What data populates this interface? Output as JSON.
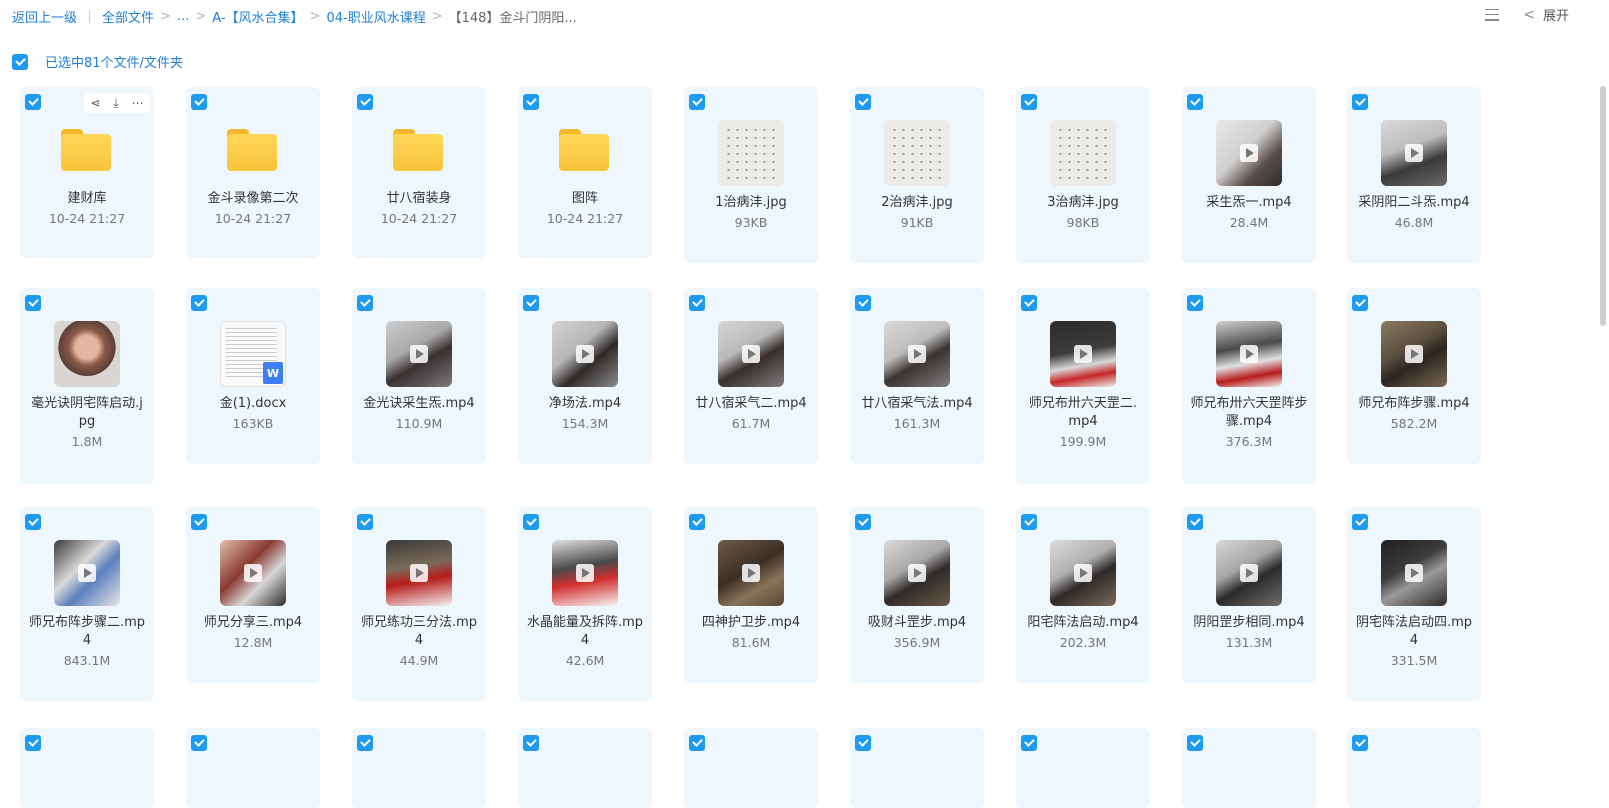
{
  "breadcrumb": {
    "back": "返回上一级",
    "all": "全部文件",
    "ellipsis": "...",
    "level1": "A-【风水合集】",
    "level2": "04-职业风水课程",
    "current": "【148】金斗门阴阳..."
  },
  "toolbar": {
    "expand_label": "展开"
  },
  "selection": {
    "label": "已选中81个文件/文件夹"
  },
  "colors": {
    "accent": "#1e9bf0",
    "card_bg": "#eef7fe",
    "link": "#1f7fd6"
  },
  "items": [
    {
      "name": "建财库",
      "meta": "10-24 21:27",
      "kind": "folder"
    },
    {
      "name": "金斗录像第二次",
      "meta": "10-24 21:27",
      "kind": "folder"
    },
    {
      "name": "廿八宿装身",
      "meta": "10-24 21:27",
      "kind": "folder"
    },
    {
      "name": "图阵",
      "meta": "10-24 21:27",
      "kind": "folder"
    },
    {
      "name": "1治病沣.jpg",
      "meta": "93KB",
      "kind": "paper"
    },
    {
      "name": "2治病沣.jpg",
      "meta": "91KB",
      "kind": "paper"
    },
    {
      "name": "3治病沣.jpg",
      "meta": "98KB",
      "kind": "paper"
    },
    {
      "name": "采生炁一.mp4",
      "meta": "28.4M",
      "kind": "video",
      "bg": "linear-gradient(135deg,#e9e9e9 0%,#cfcfcf 45%,#5a4f4a 70%,#2b2b2b 100%)"
    },
    {
      "name": "采阴阳二斗炁.mp4",
      "meta": "46.8M",
      "kind": "video",
      "bg": "linear-gradient(160deg,#d9d9d9 0%,#bdbdbd 40%,#3a3a3a 65%,#6a6a6a 100%)"
    },
    {
      "name": "毫光诀阴宅阵启动.jpg",
      "meta": "1.8M",
      "kind": "image",
      "bg": "radial-gradient(circle at 50% 40%,#e3b8a0 0 22%,#8a5a48 35%,#5a3f36 55%,#d9d6d2 56%)"
    },
    {
      "name": "金(1).docx",
      "meta": "163KB",
      "kind": "doc"
    },
    {
      "name": "金光诀采生炁.mp4",
      "meta": "110.9M",
      "kind": "video",
      "bg": "linear-gradient(150deg,#cdcdcd 0%,#a9a9a9 40%,#3a3030 60%,#7b7b7b 100%)"
    },
    {
      "name": "净场法.mp4",
      "meta": "154.3M",
      "kind": "video",
      "bg": "linear-gradient(140deg,#d2d2d2 0%,#b7b7b7 40%,#2e2a28 62%,#8d8d8d 100%)"
    },
    {
      "name": "廿八宿采气二.mp4",
      "meta": "61.7M",
      "kind": "video",
      "bg": "linear-gradient(150deg,#d6d6d6 0%,#b9b9b9 40%,#362e2a 60%,#7e7e7e 100%)"
    },
    {
      "name": "廿八宿采气法.mp4",
      "meta": "161.3M",
      "kind": "video",
      "bg": "linear-gradient(150deg,#d9d9d9 0%,#bdbdbd 40%,#3a3330 60%,#808080 100%)"
    },
    {
      "name": "师兄布卅六天罡二.mp4",
      "meta": "199.9M",
      "kind": "video",
      "bg": "linear-gradient(170deg,#2b2b2b 0%,#3c3c3c 45%,#d8d8d8 65%,#c62828 80%,#eeeeee 100%)"
    },
    {
      "name": "师兄布卅六天罡阵步骤.mp4",
      "meta": "376.3M",
      "kind": "video",
      "bg": "linear-gradient(170deg,#cfcfcf 0%,#4a4a4a 40%,#e0e0e0 62%,#b71c1c 80%,#f1f1f1 100%)"
    },
    {
      "name": "师兄布阵步骤.mp4",
      "meta": "582.2M",
      "kind": "video",
      "bg": "linear-gradient(150deg,#8a7a60 0%,#5c5040 40%,#2b2420 60%,#7a6a52 100%)"
    },
    {
      "name": "师兄布阵步骤二.mp4",
      "meta": "843.1M",
      "kind": "video",
      "bg": "linear-gradient(135deg,#3a3a3a 0%,#d9d9d9 40%,#5b7fbf 60%,#e6e6e6 100%)"
    },
    {
      "name": "师兄分享三.mp4",
      "meta": "12.8M",
      "kind": "video",
      "bg": "linear-gradient(135deg,#e1c0a8 0%,#8a3a32 40%,#d7d7d7 65%,#2a2a2a 100%)"
    },
    {
      "name": "师兄练功三分法.mp4",
      "meta": "44.9M",
      "kind": "video",
      "bg": "linear-gradient(170deg,#3a3a3a 0%,#7a6a5a 40%,#b71c1c 60%,#f2f2f2 100%)"
    },
    {
      "name": "水晶能量及拆阵.mp4",
      "meta": "42.6M",
      "kind": "video",
      "bg": "linear-gradient(170deg,#e0e0e0 0%,#4a4a4a 40%,#d32f2f 62%,#f5f5f5 100%)"
    },
    {
      "name": "四神护卫步.mp4",
      "meta": "81.6M",
      "kind": "video",
      "bg": "linear-gradient(150deg,#6e5a48 0%,#3a2e26 45%,#8a7258 70%,#5a4636 100%)"
    },
    {
      "name": "吸财斗罡步.mp4",
      "meta": "356.9M",
      "kind": "video",
      "bg": "linear-gradient(150deg,#d9d9d9 0%,#a8a8a8 40%,#2e2a28 60%,#6a5a48 100%)"
    },
    {
      "name": "阳宅阵法启动.mp4",
      "meta": "202.3M",
      "kind": "video",
      "bg": "linear-gradient(150deg,#dcdcdc 0%,#b0b0b0 40%,#2e2a28 60%,#7a6a58 100%)"
    },
    {
      "name": "阴阳罡步相同.mp4",
      "meta": "131.3M",
      "kind": "video",
      "bg": "linear-gradient(150deg,#d8d8d8 0%,#a6a6a6 40%,#2b2b2b 60%,#6e6e6e 100%)"
    },
    {
      "name": "阴宅阵法启动四.mp4",
      "meta": "331.5M",
      "kind": "video",
      "bg": "linear-gradient(150deg,#1f1f1f 0%,#3c3c3c 40%,#9a9a9a 60%,#2a2a2a 100%)"
    },
    {
      "name": "",
      "meta": "",
      "kind": "partial"
    },
    {
      "name": "",
      "meta": "",
      "kind": "partial"
    },
    {
      "name": "",
      "meta": "",
      "kind": "partial"
    },
    {
      "name": "",
      "meta": "",
      "kind": "partial"
    },
    {
      "name": "",
      "meta": "",
      "kind": "partial"
    },
    {
      "name": "",
      "meta": "",
      "kind": "partial"
    },
    {
      "name": "",
      "meta": "",
      "kind": "partial"
    },
    {
      "name": "",
      "meta": "",
      "kind": "partial"
    },
    {
      "name": "",
      "meta": "",
      "kind": "partial"
    }
  ]
}
